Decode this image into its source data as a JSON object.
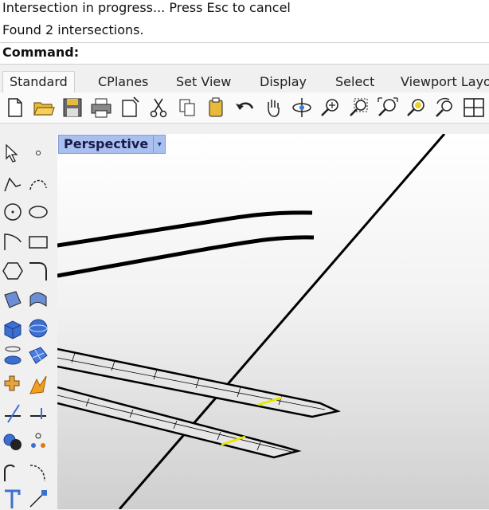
{
  "command_history": {
    "line1": "Intersection in progress... Press Esc to cancel",
    "line2": "Found 2 intersections."
  },
  "command_prompt": {
    "label": "Command:",
    "value": ""
  },
  "tabs": [
    "Standard",
    "CPlanes",
    "Set View",
    "Display",
    "Select",
    "Viewport Layo"
  ],
  "active_tab": "Standard",
  "toolbar_icons": [
    "new-file-icon",
    "open-folder-icon",
    "save-icon",
    "print-icon",
    "import-icon",
    "cut-icon",
    "copy-icon",
    "paste-icon",
    "undo-icon",
    "pan-hand-icon",
    "rotate-view-icon",
    "zoom-dynamic-icon",
    "zoom-window-icon",
    "zoom-extents-icon",
    "zoom-selected-icon",
    "rotate-camera-icon",
    "four-viewports-icon"
  ],
  "left_toolbar_icons": [
    "select-arrow-icon",
    "point-icon",
    "polyline-icon",
    "curve-icon",
    "circle-icon",
    "ellipse-icon",
    "arc-icon",
    "rectangle-icon",
    "polygon-icon",
    "fillet-curve-icon",
    "surface-icon",
    "loft-surface-icon",
    "box-icon",
    "sphere-icon",
    "cylinder-icon",
    "mesh-icon",
    "explode-icon",
    "transform-icon",
    "trim-icon",
    "split-icon",
    "boolean-icon",
    "array-icon",
    "blend-icon",
    "curve-options-icon",
    "text-icon",
    "dimension-icon"
  ],
  "viewport": {
    "title": "Perspective"
  },
  "colors": {
    "viewport_tab_bg": "#a9c0ef",
    "intersection_highlight": "#e6e600",
    "geometry_stroke": "#000000"
  }
}
